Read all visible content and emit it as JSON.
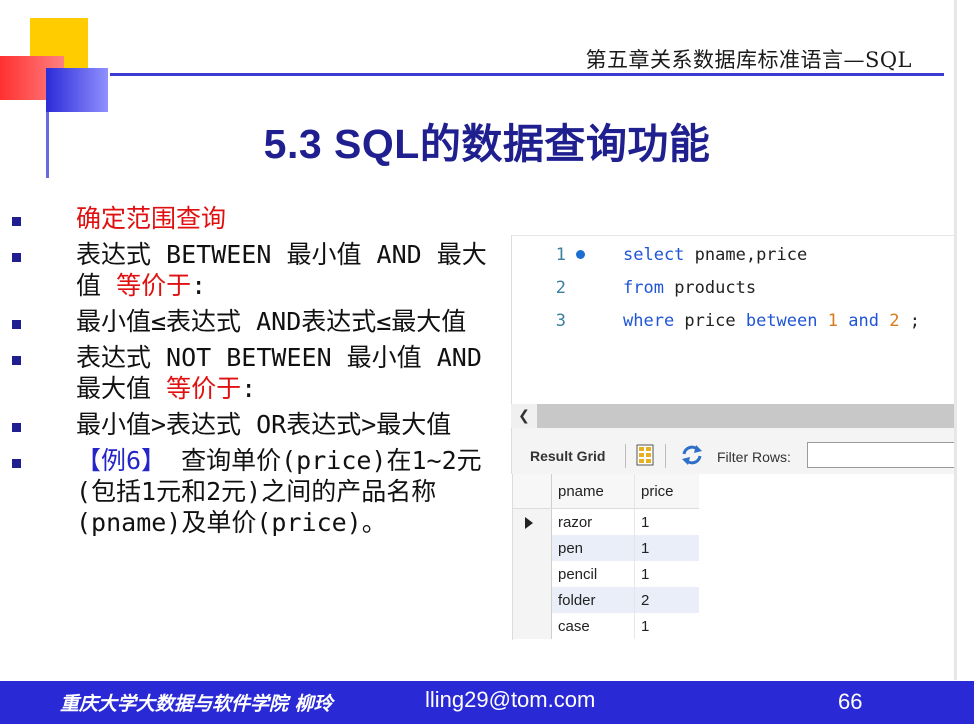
{
  "header": {
    "chapter": "第五章关系数据库标准语言—SQL"
  },
  "slide": {
    "title": "5.3 SQL的数据查询功能"
  },
  "bullets": {
    "b1": "确定范围查询",
    "b2_pre": "表达式 BETWEEN 最小值 AND 最大值 ",
    "b2_red": "等价于",
    "b2_post": ":",
    "b3": "最小值≤表达式 AND表达式≤最大值",
    "b4_pre": "表达式 NOT BETWEEN 最小值 AND 最大值 ",
    "b4_red": "等价于",
    "b4_post": ":",
    "b5": "最小值>表达式 OR表达式>最大值",
    "b6_example": "【例6】",
    "b6_text": " 查询单价(price)在1~2元(包括1元和2元)之间的产品名称(pname)及单价(price)。"
  },
  "editor": {
    "lines": [
      {
        "number": "1",
        "kw1": "select",
        "rest": " pname,price"
      },
      {
        "number": "2",
        "kw1": "from",
        "rest": " products"
      },
      {
        "number": "3",
        "kw1": "where",
        "rest": " price ",
        "kw2": "between",
        "n1": "1",
        "kw3": "and",
        "n2": "2",
        "end": " ;"
      }
    ]
  },
  "result": {
    "tab_label": "Result Grid",
    "filter_label": "Filter Rows:",
    "filter_value": "",
    "columns": [
      "pname",
      "price"
    ],
    "rows": [
      [
        "razor",
        "1"
      ],
      [
        "pen",
        "1"
      ],
      [
        "pencil",
        "1"
      ],
      [
        "folder",
        "2"
      ],
      [
        "case",
        "1"
      ]
    ]
  },
  "footer": {
    "author": "重庆大学大数据与软件学院 柳玲",
    "email": "lling29@tom.com",
    "page": "66"
  },
  "colors": {
    "accent": "#2929d6",
    "title": "#1f1f8f",
    "highlight": "#e01010",
    "deco_yellow": "#ffcc00",
    "deco_red": "#ff4040"
  }
}
